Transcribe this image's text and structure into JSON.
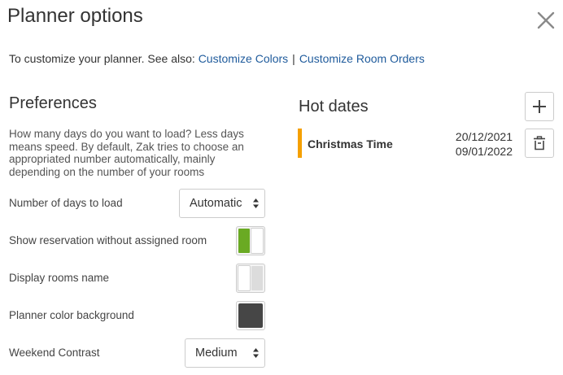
{
  "header": {
    "title": "Planner options",
    "close_icon": "close-icon"
  },
  "intro": {
    "text": "To customize your planner. See also:",
    "link_colors": "Customize Colors",
    "separator": "|",
    "link_room_orders": "Customize Room Orders"
  },
  "preferences": {
    "title": "Preferences",
    "description": "How many days do you want to load? Less days means speed. By default, Zak tries to choose an appropriated number automatically, mainly depending on the number of your rooms",
    "days_to_load": {
      "label": "Number of days to load",
      "value": "Automatic"
    },
    "show_unassigned": {
      "label": "Show reservation without assigned room",
      "checked": true
    },
    "display_rooms_name": {
      "label": "Display rooms name",
      "checked": false
    },
    "planner_color": {
      "label": "Planner color background",
      "color": "#464646"
    },
    "weekend_contrast": {
      "label": "Weekend Contrast",
      "value": "Medium"
    }
  },
  "hot_dates": {
    "title": "Hot dates",
    "add_icon": "plus-icon",
    "delete_icon": "trash-icon",
    "items": [
      {
        "name": "Christmas Time",
        "start": "20/12/2021",
        "end": "09/01/2022",
        "accent": "#f5a000"
      }
    ]
  },
  "colors": {
    "link": "#1f5b9c",
    "toggle_on": "#6aaa23"
  }
}
